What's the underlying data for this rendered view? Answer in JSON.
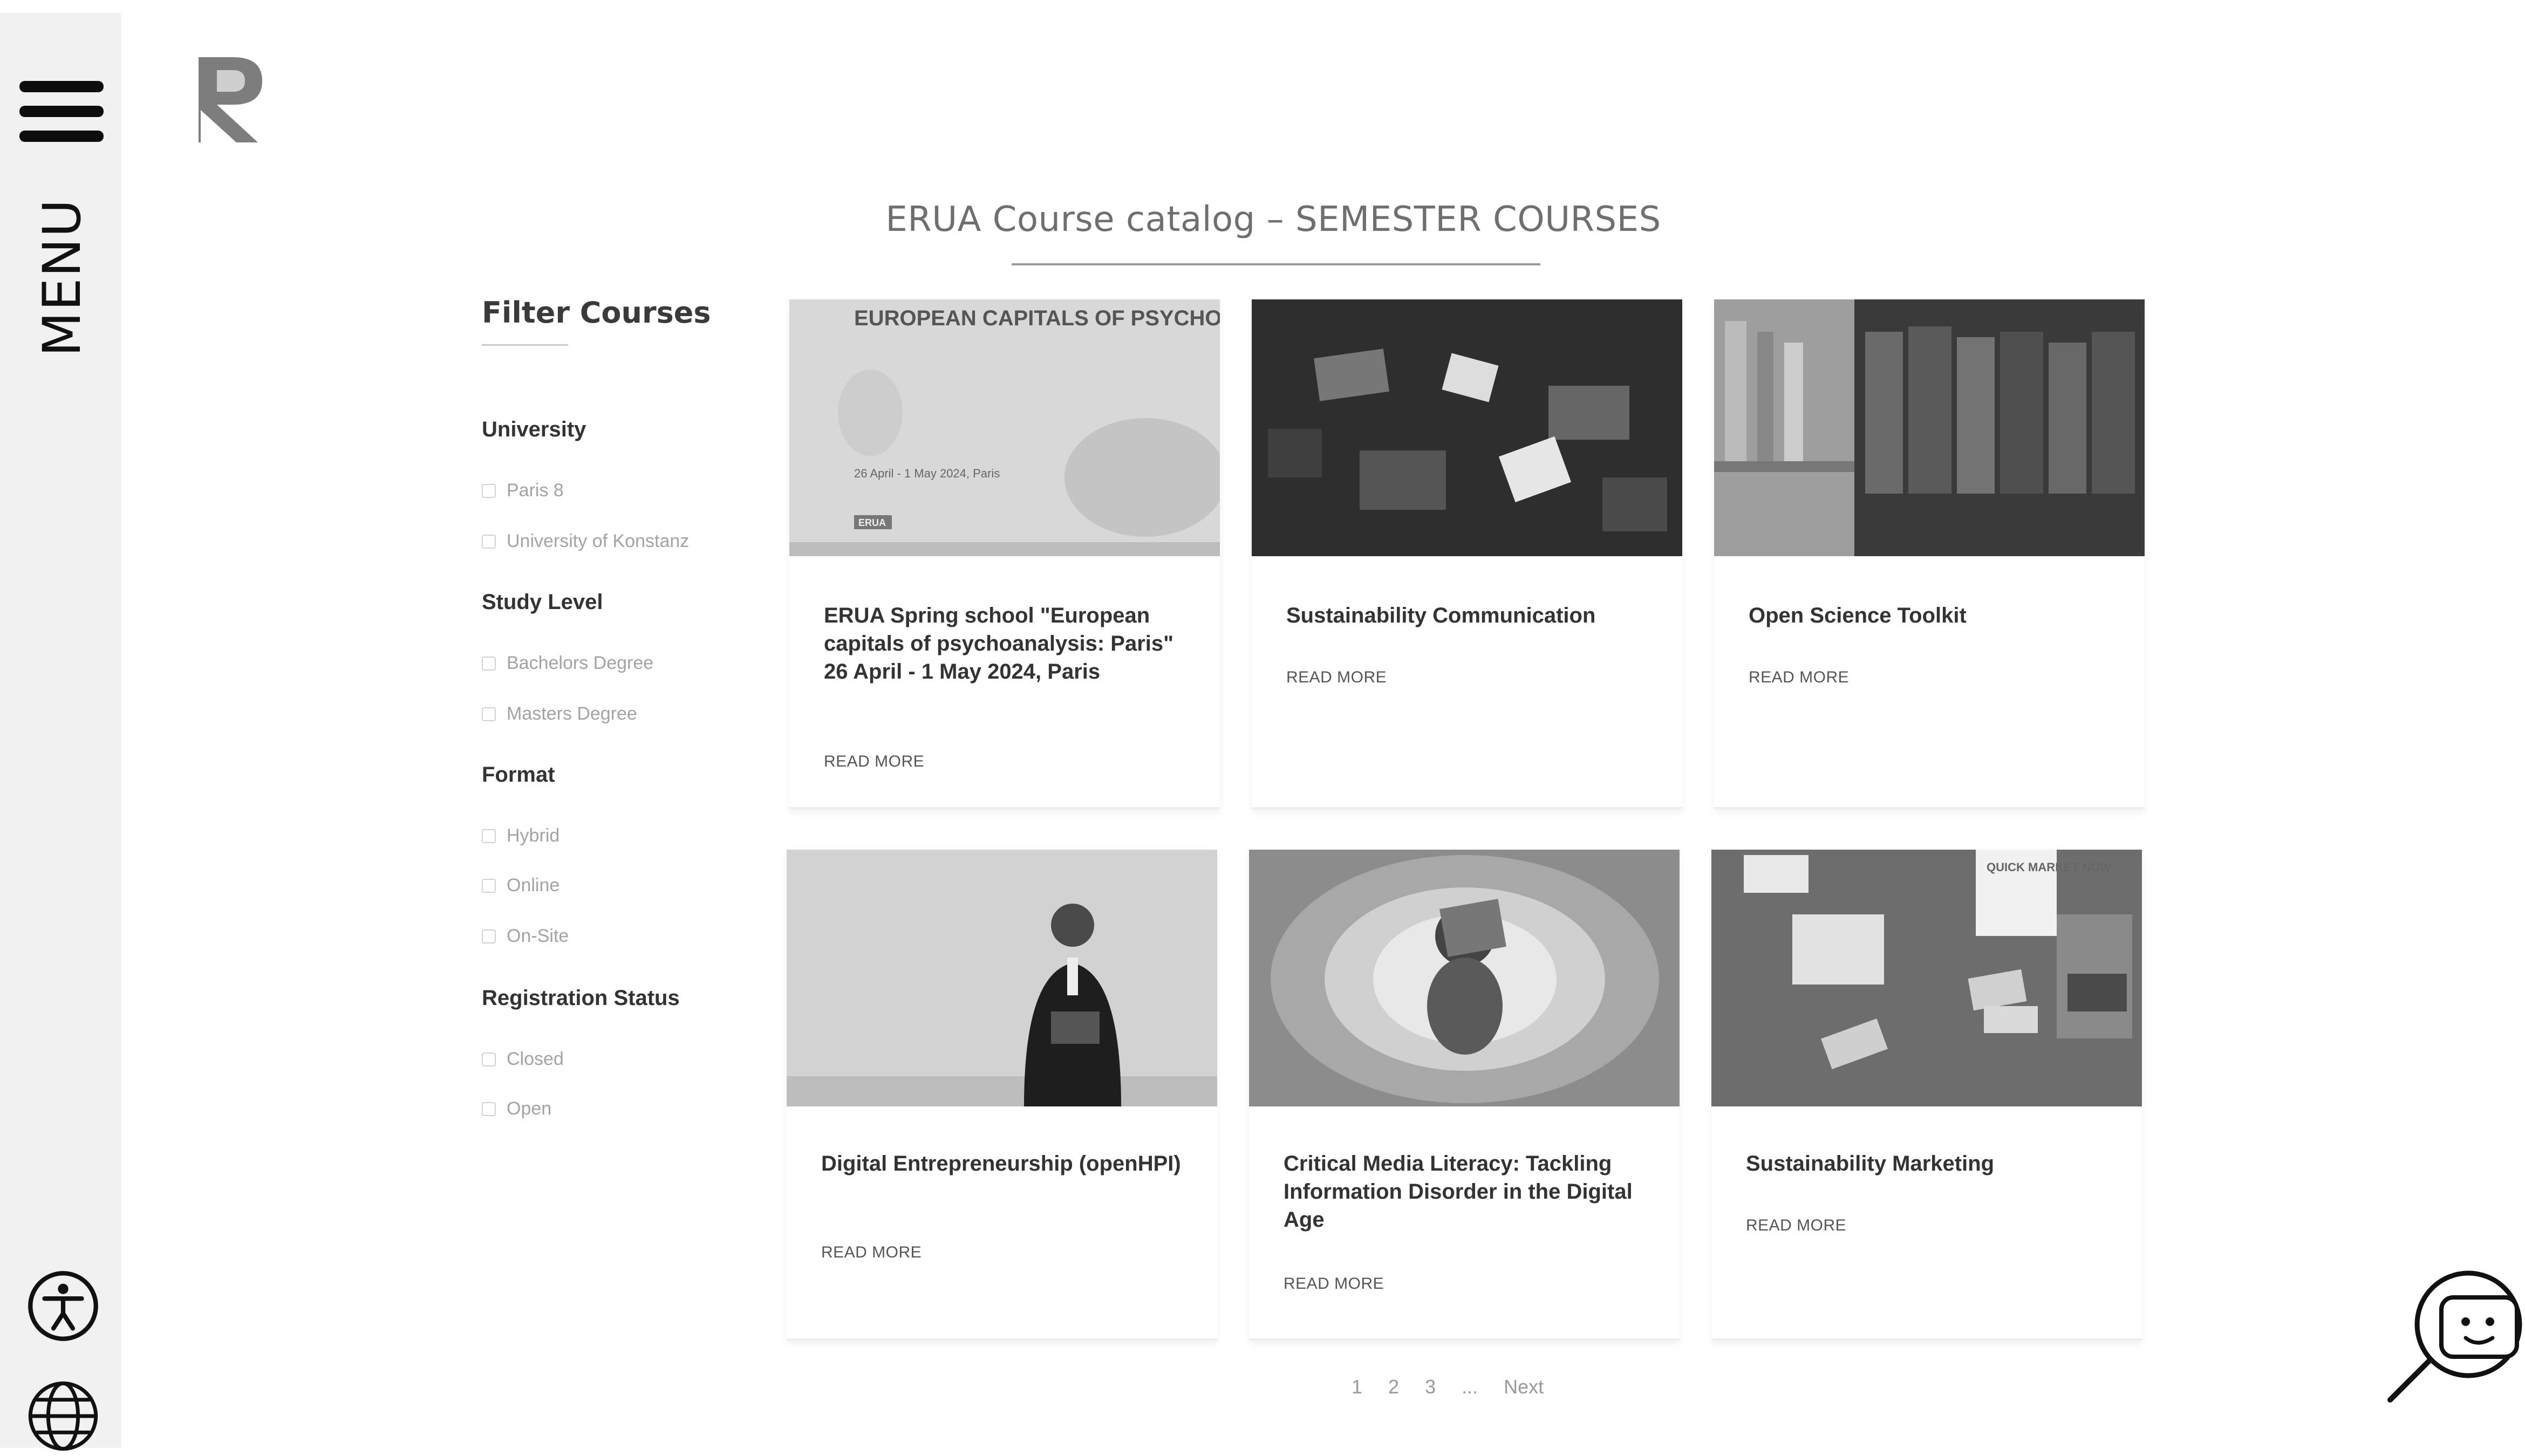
{
  "sidebar": {
    "menu_label": "MENU",
    "icons": [
      "hamburger-icon",
      "accessibility-icon",
      "globe-icon"
    ]
  },
  "page": {
    "title": "ERUA Course catalog – SEMESTER COURSES"
  },
  "filters": {
    "heading": "Filter Courses",
    "groups": [
      {
        "title": "University",
        "options": [
          "Paris 8",
          "University of Konstanz"
        ]
      },
      {
        "title": "Study Level",
        "options": [
          "Bachelors Degree",
          "Masters Degree"
        ]
      },
      {
        "title": "Format",
        "options": [
          "Hybrid",
          "Online",
          "On-Site"
        ]
      },
      {
        "title": "Registration Status",
        "options": [
          "Closed",
          "Open"
        ]
      }
    ]
  },
  "courses": [
    {
      "title": "ERUA Spring school \"European capitals of psychoanalysis: Paris\" 26 April - 1 May 2024, Paris",
      "read_more": "READ MORE",
      "image_text": {
        "heading": "EUROPEAN CAPITALS OF PSYCHOANALYSIS: PARIS",
        "dates": "26 April - 1 May 2024, Paris",
        "badge": "ERUA"
      }
    },
    {
      "title": "Sustainability Communication",
      "read_more": "READ MORE"
    },
    {
      "title": "Open Science Toolkit",
      "read_more": "READ MORE"
    },
    {
      "title": "Digital Entrepreneurship (openHPI)",
      "read_more": "READ MORE"
    },
    {
      "title": "Critical Media Literacy: Tackling Information Disorder in the Digital Age",
      "read_more": "READ MORE"
    },
    {
      "title": "Sustainability Marketing",
      "read_more": "READ MORE",
      "image_text": {
        "note": "QUICK MARKET NOW"
      }
    }
  ],
  "pagination": {
    "pages": [
      "1",
      "2",
      "3",
      "..."
    ],
    "next": "Next"
  },
  "colors": {
    "text_dark": "#333333",
    "muted": "#a3a3a3",
    "sidebar_bg": "#f1f1f1"
  }
}
